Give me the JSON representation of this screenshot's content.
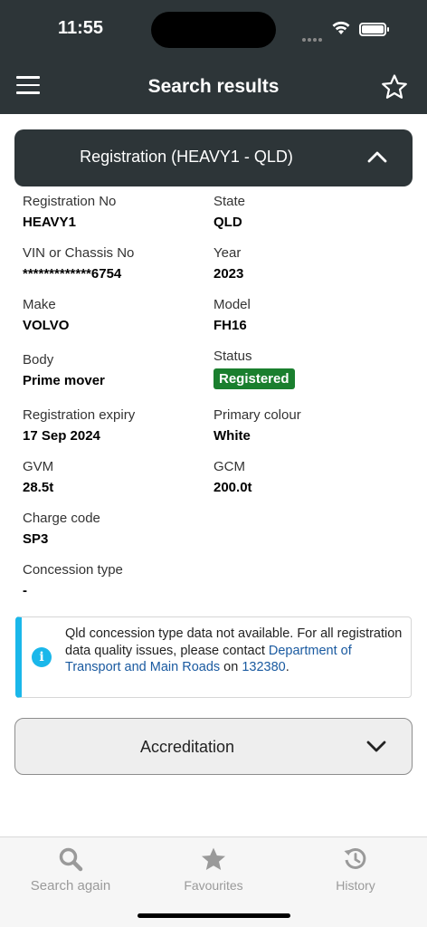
{
  "status_bar": {
    "time": "11:55"
  },
  "header": {
    "title": "Search results"
  },
  "registration_panel": {
    "title": "Registration (HEAVY1 - QLD)"
  },
  "fields": {
    "registration_no": {
      "label": "Registration No",
      "value": "HEAVY1"
    },
    "state": {
      "label": "State",
      "value": "QLD"
    },
    "vin": {
      "label": "VIN or Chassis No",
      "value": "*************6754"
    },
    "year": {
      "label": "Year",
      "value": "2023"
    },
    "make": {
      "label": "Make",
      "value": "VOLVO"
    },
    "model": {
      "label": "Model",
      "value": "FH16"
    },
    "body": {
      "label": "Body",
      "value": "Prime mover"
    },
    "status": {
      "label": "Status",
      "value": "Registered"
    },
    "expiry": {
      "label": "Registration expiry",
      "value": "17 Sep 2024"
    },
    "colour": {
      "label": "Primary colour",
      "value": "White"
    },
    "gvm": {
      "label": "GVM",
      "value": "28.5t"
    },
    "gcm": {
      "label": "GCM",
      "value": "200.0t"
    },
    "charge_code": {
      "label": "Charge code",
      "value": "SP3"
    },
    "concession": {
      "label": "Concession type",
      "value": "-"
    }
  },
  "info": {
    "text_before": "Qld concession type data not available. For all registration data quality issues, please contact ",
    "link_text": "Department of Transport and Main Roads",
    "text_middle": " on ",
    "phone": "132380",
    "text_after": "."
  },
  "accreditation_panel": {
    "title": "Accreditation"
  },
  "bottom_nav": {
    "items": [
      {
        "label": "Search again",
        "icon": "search-icon"
      },
      {
        "label": "Favourites",
        "icon": "star-icon"
      },
      {
        "label": "History",
        "icon": "history-icon"
      }
    ]
  },
  "colors": {
    "header_bg": "#2d3538",
    "status_badge": "#1a7f2e",
    "info_accent": "#1ab7ea",
    "link": "#1a5aa0"
  }
}
